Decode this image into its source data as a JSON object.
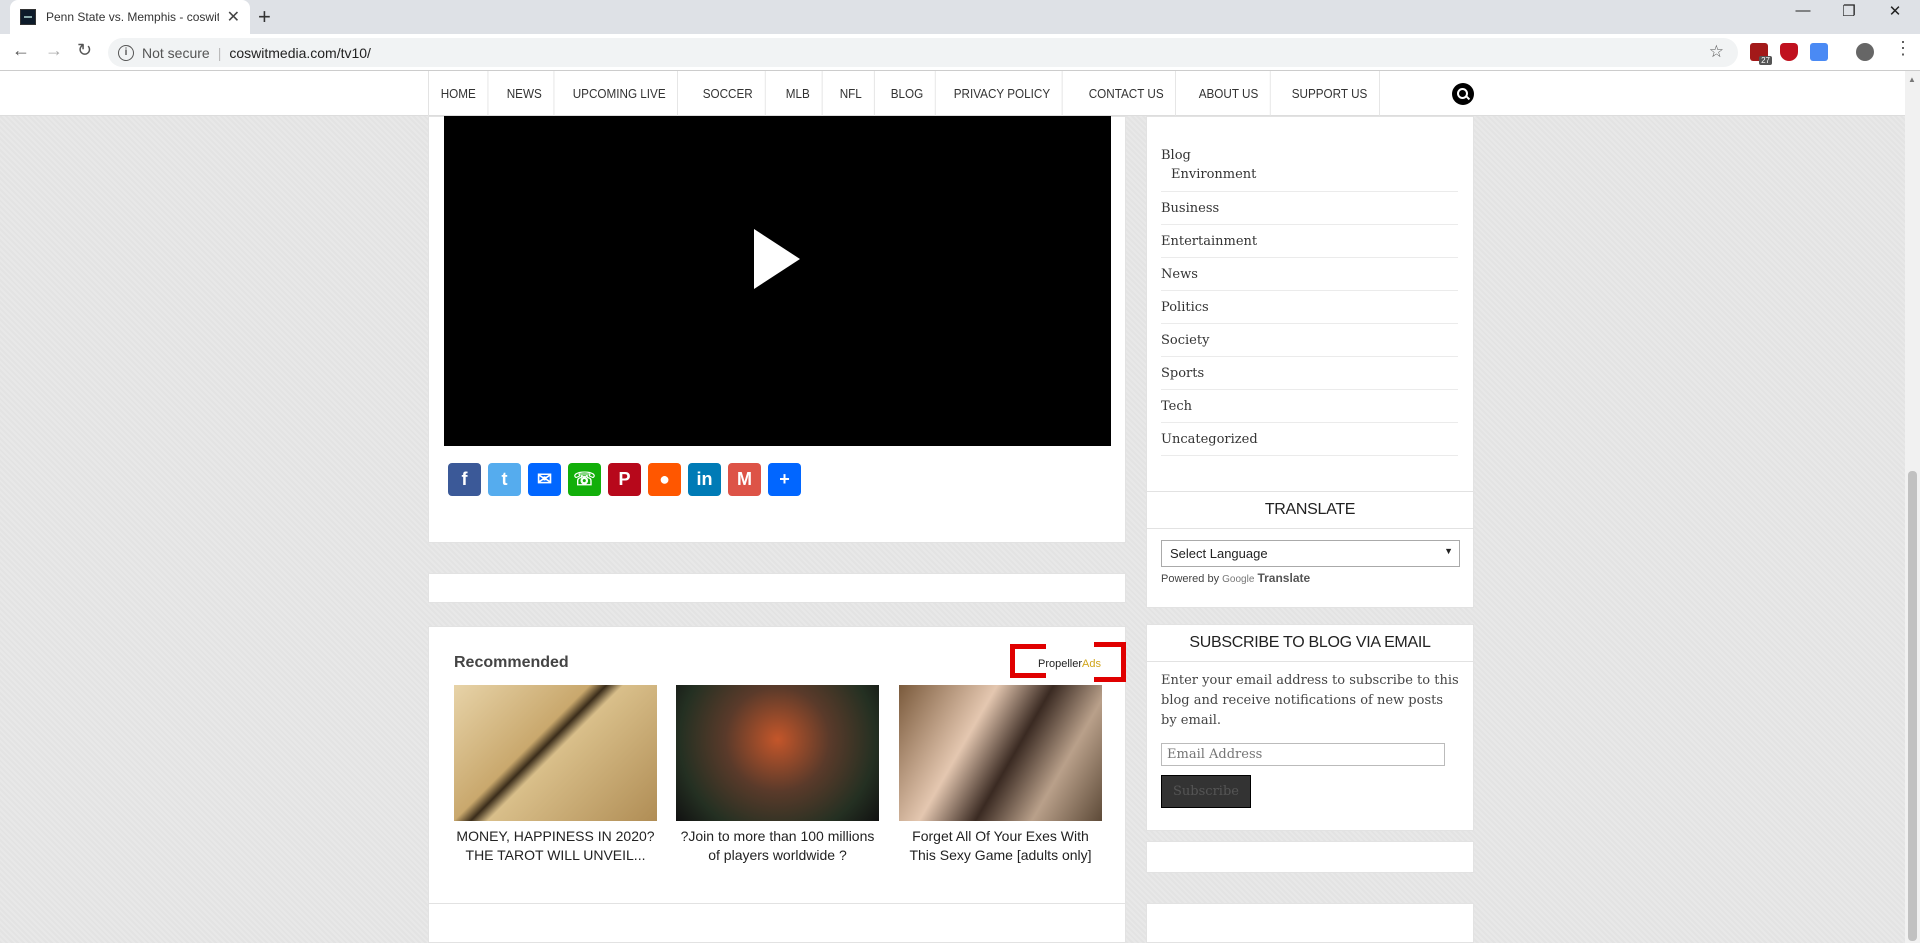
{
  "browser": {
    "tab_title": "Penn State vs. Memphis - coswitmedia",
    "url_secure_label": "Not secure",
    "url": "coswitmedia.com/tv10/",
    "extension_badge": "27"
  },
  "nav": {
    "items": [
      "HOME",
      "NEWS",
      "UPCOMING LIVE",
      "SOCCER",
      "MLB",
      "NFL",
      "BLOG",
      "PRIVACY POLICY",
      "CONTACT US",
      "ABOUT US",
      "SUPPORT US"
    ]
  },
  "share": [
    {
      "name": "facebook",
      "glyph": "f",
      "color": "#3b5998"
    },
    {
      "name": "twitter",
      "glyph": "t",
      "color": "#55acee"
    },
    {
      "name": "email",
      "glyph": "✉",
      "color": "#0166ff"
    },
    {
      "name": "whatsapp",
      "glyph": "☏",
      "color": "#12af0a"
    },
    {
      "name": "pinterest",
      "glyph": "P",
      "color": "#b7081b"
    },
    {
      "name": "reddit",
      "glyph": "●",
      "color": "#ff5700"
    },
    {
      "name": "linkedin",
      "glyph": "in",
      "color": "#007bb6"
    },
    {
      "name": "gmail",
      "glyph": "M",
      "color": "#dd5347"
    },
    {
      "name": "share",
      "glyph": "+",
      "color": "#0166ff"
    }
  ],
  "recommended": {
    "title": "Recommended",
    "provider_a": "Propeller",
    "provider_b": "Ads",
    "items": [
      {
        "caption": "MONEY, HAPPINESS IN 2020? THE TAROT WILL UNVEIL..."
      },
      {
        "caption": "?Join to more than 100 millions of players worldwide ?"
      },
      {
        "caption": "Forget All Of Your Exes With This Sexy Game [adults only]"
      }
    ]
  },
  "sidebar": {
    "categories": [
      "Blog",
      "Environment",
      "Business",
      "Entertainment",
      "News",
      "Politics",
      "Society",
      "Sports",
      "Tech",
      "Uncategorized"
    ],
    "translate_title": "TRANSLATE",
    "select_language": "Select Language",
    "powered_by": "Powered by",
    "google": "Google",
    "translate": "Translate",
    "subscribe_title": "SUBSCRIBE TO BLOG VIA EMAIL",
    "subscribe_desc": "Enter your email address to subscribe to this blog and receive notifications of new posts by email.",
    "email_placeholder": "Email Address",
    "subscribe_button": "Subscribe"
  },
  "colors": {
    "propeller_ads": "#d1a51a",
    "highlight": "#e00000"
  }
}
